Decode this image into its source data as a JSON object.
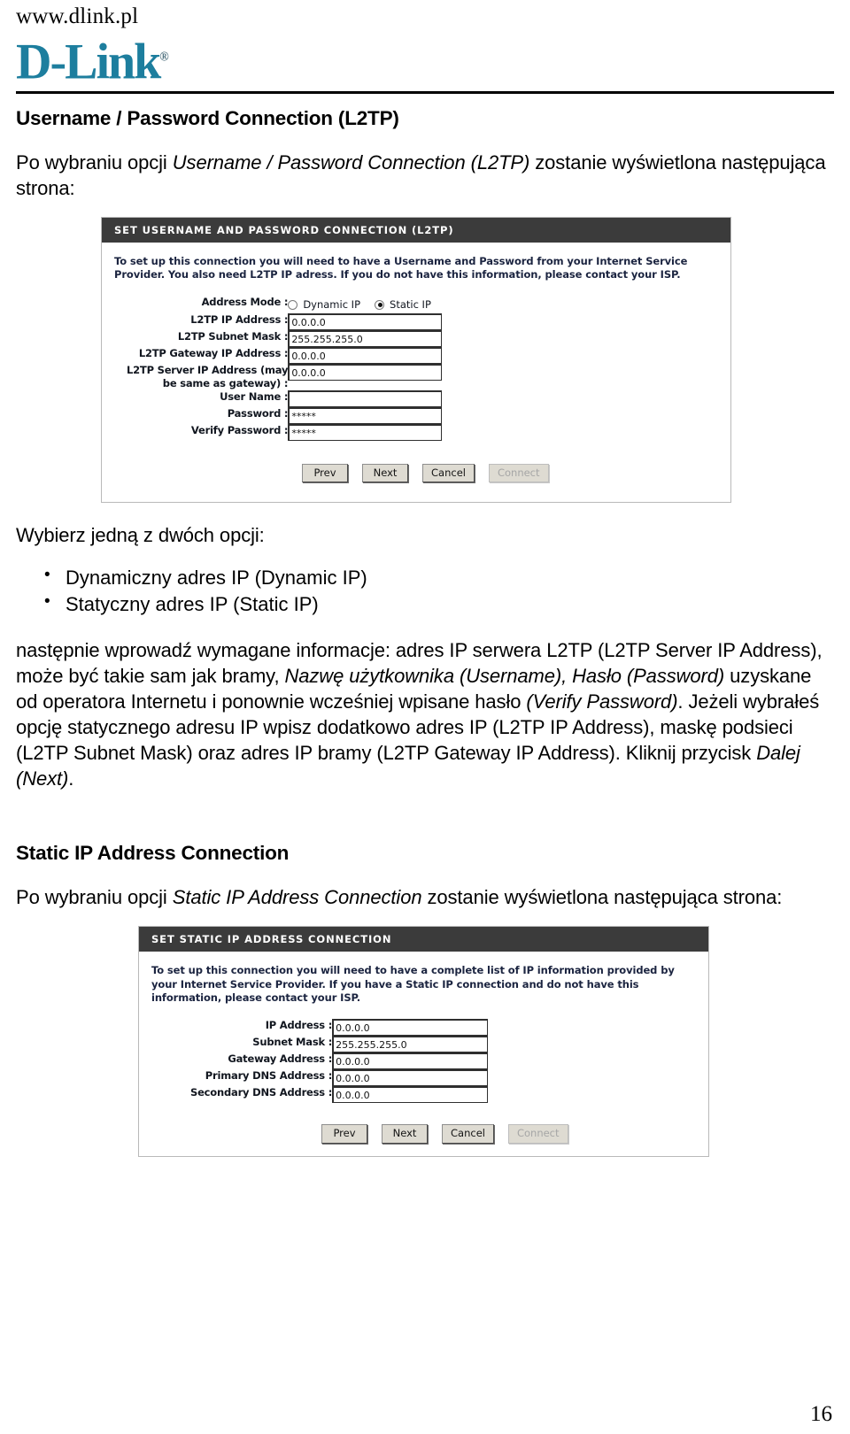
{
  "header": {
    "site_url": "www.dlink.pl",
    "logo_text": "D-Link",
    "logo_reg": "®",
    "logo_color": "#1d7e9e"
  },
  "section_one": {
    "heading": "Username / Password Connection (L2TP)",
    "intro_before": "Po wybraniu opcji ",
    "intro_italic": "Username / Password Connection (L2TP)",
    "intro_after": " zostanie wyświetlona następująca strona:"
  },
  "panel_l2tp": {
    "title": "SET USERNAME AND PASSWORD CONNECTION (L2TP)",
    "description": "To set up this connection you will need to have a Username and Password from your Internet Service Provider. You also need L2TP IP adress. If you do not have this information, please contact your ISP.",
    "address_mode_label": "Address Mode :",
    "radio_dynamic_label": "Dynamic IP",
    "radio_static_label": "Static IP",
    "selected_mode": "Static IP",
    "fields": [
      {
        "label": "L2TP IP Address :",
        "value": "0.0.0.0"
      },
      {
        "label": "L2TP Subnet Mask :",
        "value": "255.255.255.0"
      },
      {
        "label": "L2TP Gateway IP Address :",
        "value": "0.0.0.0"
      },
      {
        "label": "L2TP Server IP Address (may\nbe same as gateway) :",
        "value": "0.0.0.0"
      },
      {
        "label": "User Name :",
        "value": ""
      },
      {
        "label": "Password :",
        "value": "*****"
      },
      {
        "label": "Verify Password :",
        "value": "*****"
      }
    ],
    "buttons": [
      {
        "label": "Prev",
        "disabled": false
      },
      {
        "label": "Next",
        "disabled": false
      },
      {
        "label": "Cancel",
        "disabled": false
      },
      {
        "label": "Connect",
        "disabled": true
      }
    ]
  },
  "choice_block": {
    "lead": "Wybierz jedną z dwóch opcji:",
    "items": [
      "Dynamiczny adres IP (Dynamic IP)",
      "Statyczny adres IP (Static IP)"
    ]
  },
  "paragraph": {
    "p1": "następnie wprowadź wymagane informacje:  adres IP serwera L2TP (L2TP Server IP Address), może być takie sam jak bramy, ",
    "p2_italic": "Nazwę użytkownika (Username), Hasło (Password)",
    "p3": " uzyskane od operatora Internetu i ponownie wcześniej wpisane hasło ",
    "p4_italic": "(Verify Password)",
    "p5": ". Jeżeli wybrałeś opcję statycznego adresu IP wpisz dodatkowo adres IP (L2TP IP Address), maskę podsieci (L2TP Subnet Mask) oraz adres IP bramy (L2TP Gateway IP Address). Kliknij przycisk ",
    "p6_italic": "Dalej (Next)",
    "p7": "."
  },
  "section_two": {
    "heading": "Static IP Address Connection",
    "intro_before": "Po wybraniu opcji ",
    "intro_italic": "Static IP Address Connection",
    "intro_after": " zostanie wyświetlona następująca strona:"
  },
  "panel_static": {
    "title": "SET STATIC IP ADDRESS CONNECTION",
    "description": "To set up this connection you will need to have a complete list of IP information provided by your Internet Service Provider. If you have a Static IP connection and do not have this information, please contact your ISP.",
    "fields": [
      {
        "label": "IP Address :",
        "value": "0.0.0.0"
      },
      {
        "label": "Subnet Mask :",
        "value": "255.255.255.0"
      },
      {
        "label": "Gateway Address :",
        "value": "0.0.0.0"
      },
      {
        "label": "Primary DNS Address :",
        "value": "0.0.0.0"
      },
      {
        "label": "Secondary DNS Address :",
        "value": "0.0.0.0"
      }
    ],
    "buttons": [
      {
        "label": "Prev",
        "disabled": false
      },
      {
        "label": "Next",
        "disabled": false
      },
      {
        "label": "Cancel",
        "disabled": false
      },
      {
        "label": "Connect",
        "disabled": true
      }
    ]
  },
  "footer": {
    "page_number": "16"
  }
}
